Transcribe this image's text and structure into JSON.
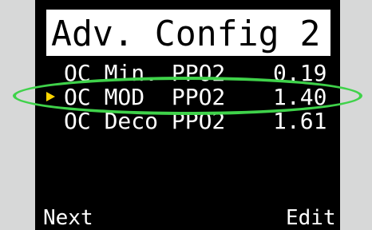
{
  "screen": {
    "title": "Adv. Config 2",
    "rows": [
      {
        "label": "OC Min. PPO2",
        "value": "0.19",
        "selected": false
      },
      {
        "label": "OC MOD  PPO2",
        "value": "1.40",
        "selected": true
      },
      {
        "label": "OC Deco PPO2",
        "value": "1.61",
        "selected": false
      }
    ],
    "softkeys": {
      "left": "Next",
      "right": "Edit"
    }
  },
  "colors": {
    "screen_background": "#000000",
    "title_background": "#ffffff",
    "text": "#ffffff",
    "cursor": "#ffd500",
    "highlight_ring": "#3fd24a",
    "frame": "#d7d8d8"
  },
  "icons": {
    "cursor": "yellow-triangle-right"
  }
}
